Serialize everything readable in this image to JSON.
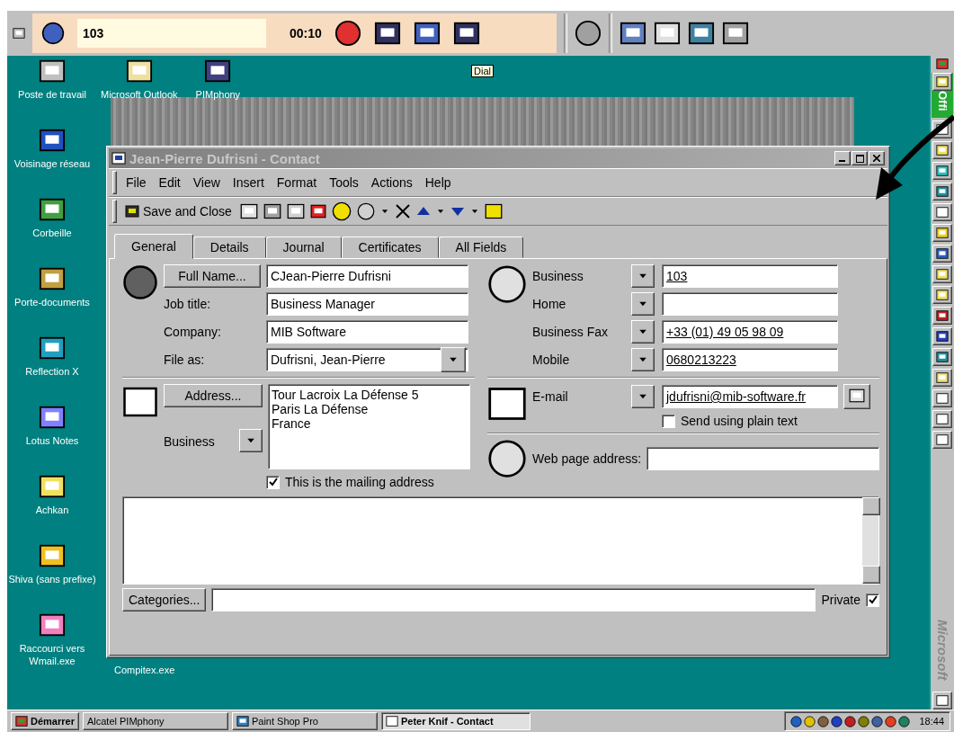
{
  "top_bar": {
    "number": "103",
    "timer": "00:10",
    "tooltip": "Dial"
  },
  "desktop_icons": [
    {
      "label": "Poste de travail"
    },
    {
      "label": "Voisinage réseau"
    },
    {
      "label": "Corbeille"
    },
    {
      "label": "Porte-documents"
    },
    {
      "label": "Reflection X"
    },
    {
      "label": "Lotus Notes"
    },
    {
      "label": "Achkan"
    },
    {
      "label": "Shiva (sans prefixe)"
    },
    {
      "label": "Raccourci vers Wmail.exe"
    }
  ],
  "desktop_top_icons": [
    {
      "label": "Microsoft Outlook"
    },
    {
      "label": "PIMphony"
    }
  ],
  "desktop_bottom_label": "Compitex.exe",
  "window": {
    "title": "Jean-Pierre Dufrisni - Contact",
    "menu": [
      "File",
      "Edit",
      "View",
      "Insert",
      "Format",
      "Tools",
      "Actions",
      "Help"
    ],
    "toolbar": {
      "save_label": "Save and Close"
    },
    "tabs": [
      {
        "label": "General",
        "selected": true
      },
      {
        "label": "Details",
        "selected": false
      },
      {
        "label": "Journal",
        "selected": false
      },
      {
        "label": "Certificates",
        "selected": false
      },
      {
        "label": "All Fields",
        "selected": false
      }
    ],
    "full_name_button": "Full Name...",
    "full_name": "CJean-Pierre Dufrisni",
    "fields": [
      {
        "label": "Job title:",
        "value": "Business Manager",
        "kind": "text"
      },
      {
        "label": "Company:",
        "value": "MIB Software",
        "kind": "text"
      },
      {
        "label": "File as:",
        "value": "Dufrisni, Jean-Pierre",
        "kind": "combo"
      }
    ],
    "phones": [
      {
        "label": "Business",
        "value": "103"
      },
      {
        "label": "Home"
      },
      {
        "label": "Business Fax",
        "value": "+33 (01) 49 05 98 09"
      },
      {
        "label": "Mobile",
        "value": "0680213223"
      }
    ],
    "address_button": "Address...",
    "address_type": "Business",
    "address_lines": [
      "Tour Lacroix La Défense 5",
      "Paris La Défense",
      "France"
    ],
    "mailing_address": {
      "label": "This is the mailing address",
      "checked": true
    },
    "email_label": "E-mail",
    "email": "jdufrisni@mib-software.fr",
    "plain_text": {
      "label": "Send using plain text",
      "checked": false
    },
    "web_label": "Web page address:",
    "categories_button": "Categories...",
    "private": {
      "label": "Private",
      "checked": true
    }
  },
  "office_bar": {
    "top_text": "Offi",
    "brand": "Microsoft"
  },
  "taskbar": {
    "start": "Démarrer",
    "tasks": [
      {
        "label": "Alcatel PIMphony",
        "selected": false
      },
      {
        "label": "Paint Shop Pro",
        "selected": false
      },
      {
        "label": "Peter Knif - Contact",
        "selected": true
      }
    ],
    "clock": "18:44"
  }
}
